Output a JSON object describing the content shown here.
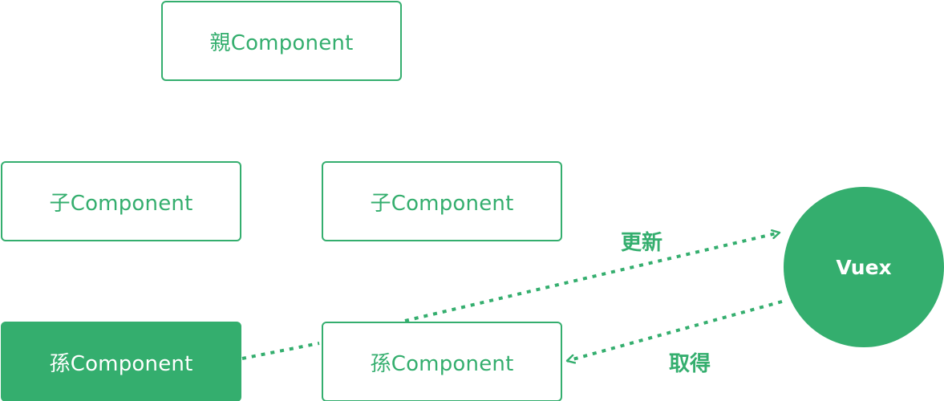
{
  "colors": {
    "accent": "#34ae6e",
    "background": "#ffffff",
    "filled_text": "#ffffff"
  },
  "nodes": {
    "parent": "親Component",
    "child_left": "子Component",
    "child_right": "子Component",
    "grandchild_left": "孫Component",
    "grandchild_right": "孫Component",
    "store": "Vuex"
  },
  "edges": {
    "update_label": "更新",
    "fetch_label": "取得"
  }
}
